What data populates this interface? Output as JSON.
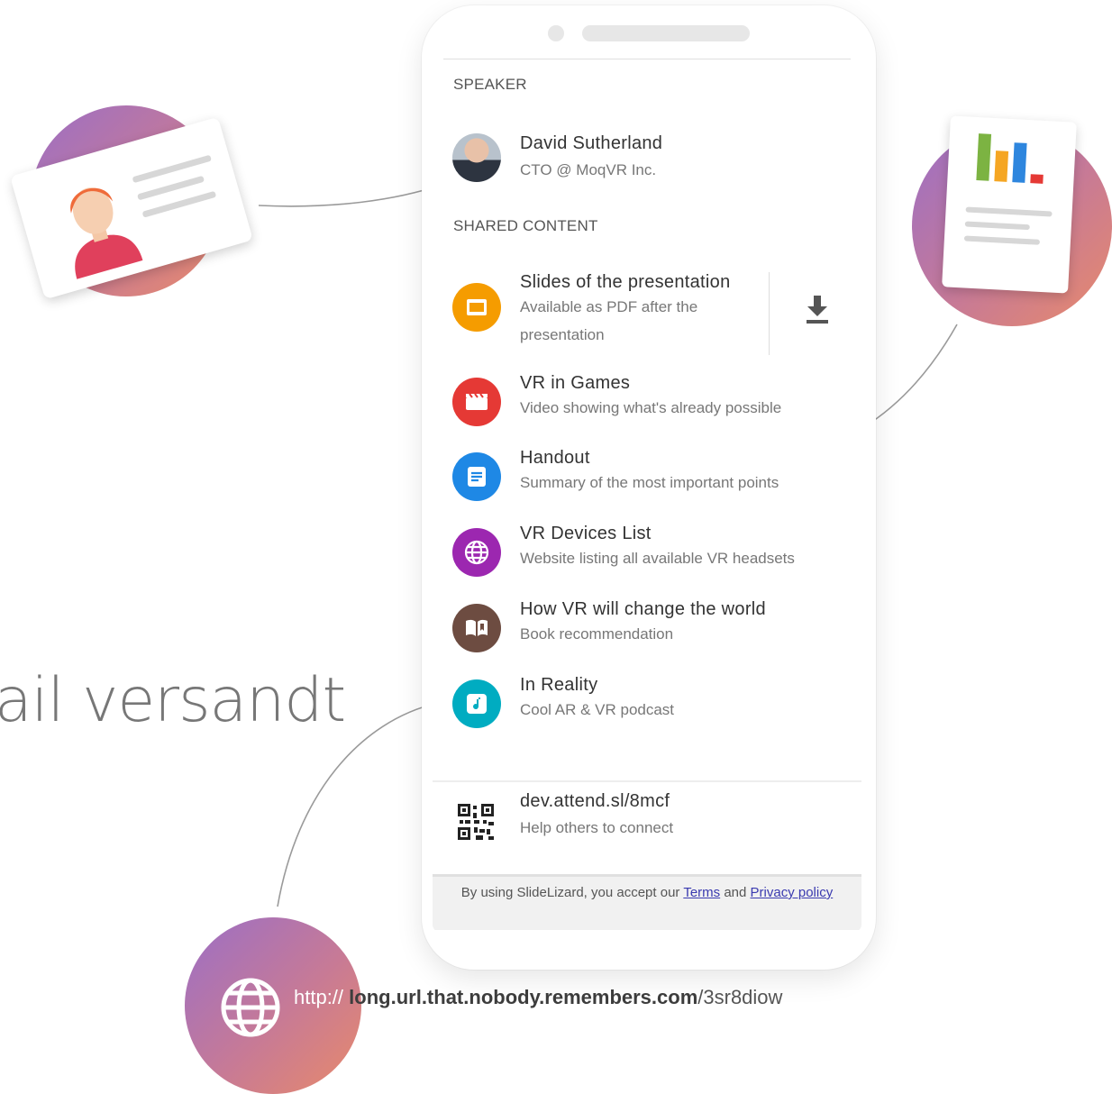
{
  "background": {
    "headline_fragment": "ail versandt"
  },
  "phone": {
    "speaker_section": {
      "title": "SPEAKER",
      "name": "David Sutherland",
      "role": "CTO @ MoqVR Inc."
    },
    "shared_section": {
      "title": "SHARED CONTENT",
      "items": [
        {
          "title": "Slides of the presentation",
          "subtitle": "Available as PDF after the presentation",
          "icon": "presentation-icon",
          "color": "#f59c00"
        },
        {
          "title": "VR in Games",
          "subtitle": "Video showing what's already possible",
          "icon": "video-icon",
          "color": "#e53935"
        },
        {
          "title": "Handout",
          "subtitle": "Summary of the most important points",
          "icon": "document-icon",
          "color": "#1e88e5"
        },
        {
          "title": "VR Devices List",
          "subtitle": "Website listing all available VR headsets",
          "icon": "globe-icon",
          "color": "#9c27b0"
        },
        {
          "title": "How VR will change the world",
          "subtitle": "Book recommendation",
          "icon": "book-icon",
          "color": "#6d4c41"
        },
        {
          "title": "In Reality",
          "subtitle": "Cool AR & VR podcast",
          "icon": "music-note-icon",
          "color": "#00acc1"
        }
      ]
    },
    "short_link": {
      "url": "dev.attend.sl/8mcf",
      "caption": "Help others to connect"
    },
    "legal": {
      "prefix": "By using SlideLizard, you accept our ",
      "terms": "Terms",
      "and": " and ",
      "privacy": "Privacy policy"
    }
  },
  "long_url": {
    "protocol": "http://",
    "host": "long.url.that.nobody.remembers.com",
    "path": "/3sr8diow"
  }
}
